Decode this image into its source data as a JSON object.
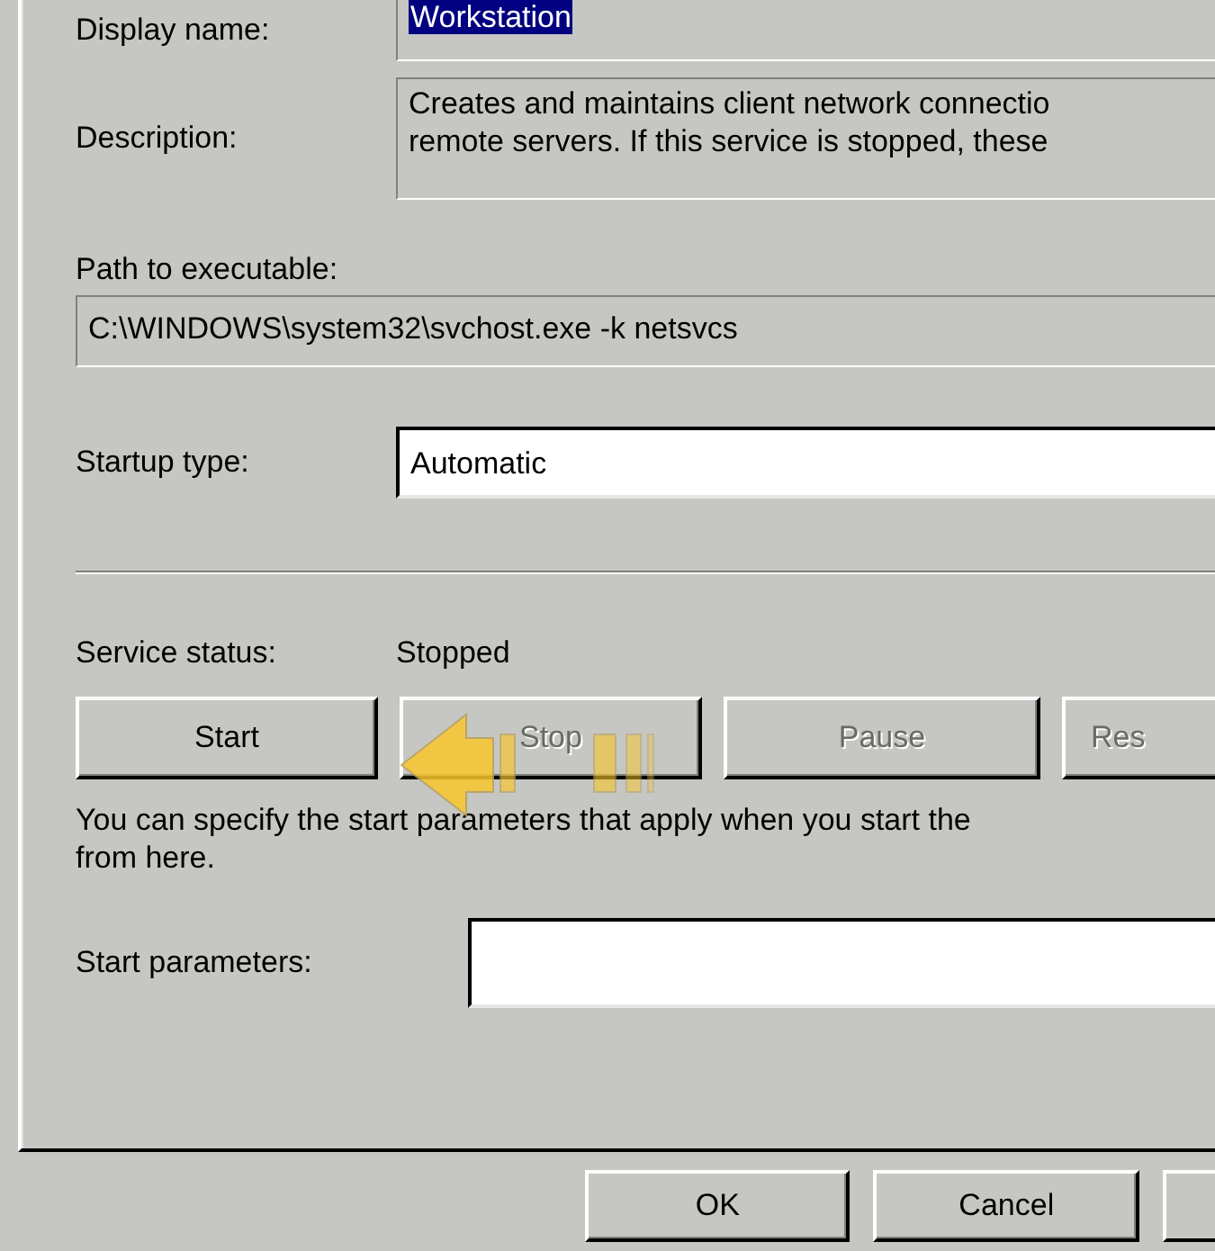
{
  "display_name": {
    "label": "Display name:",
    "value": "Workstation",
    "selected": true
  },
  "description": {
    "label": "Description:",
    "lines": [
      "Creates and maintains client network connectio",
      "remote servers. If this service is stopped, these"
    ]
  },
  "path": {
    "label": "Path to executable:",
    "value": "C:\\WINDOWS\\system32\\svchost.exe -k netsvcs"
  },
  "startup_type": {
    "label": "Startup type:",
    "value": "Automatic"
  },
  "service_status": {
    "label": "Service status:",
    "value": "Stopped"
  },
  "service_buttons": [
    {
      "label": "Start",
      "disabled": false
    },
    {
      "label": "Stop",
      "disabled": true
    },
    {
      "label": "Pause",
      "disabled": true
    },
    {
      "label": "Res",
      "disabled": true
    }
  ],
  "hint": "You can specify the start parameters that apply when you start the\nfrom here.",
  "start_parameters": {
    "label": "Start parameters:"
  },
  "dialog_buttons": [
    "OK",
    "Cancel"
  ]
}
